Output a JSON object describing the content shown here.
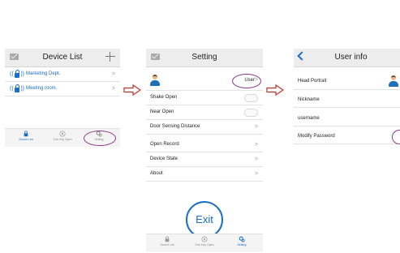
{
  "device_list": {
    "title": "Device List",
    "devices": [
      {
        "label": "Marketing Dept.",
        "chevron": ">"
      },
      {
        "label": "Meeting room.",
        "chevron": ">"
      }
    ],
    "tabs": [
      {
        "label": "Device List",
        "icon": "lock-icon"
      },
      {
        "label": "One Key Open",
        "icon": "compass-icon"
      },
      {
        "label": "Setting",
        "icon": "gear-icon"
      }
    ]
  },
  "setting": {
    "title": "Setting",
    "user_button": "User",
    "rows": [
      {
        "label": "Shake Open",
        "control": "toggle"
      },
      {
        "label": "Near Open",
        "control": "toggle"
      },
      {
        "label": "Door Sensing Distance",
        "chevron": ">"
      },
      {
        "label": "Open Record",
        "chevron": ">"
      },
      {
        "label": "Device State",
        "chevron": ">"
      },
      {
        "label": "About",
        "chevron": ">"
      }
    ],
    "exit_label": "Exit",
    "tabs": [
      {
        "label": "Device List"
      },
      {
        "label": "One Key Open"
      },
      {
        "label": "Setting"
      }
    ]
  },
  "user_info": {
    "title": "User info",
    "rows": [
      {
        "label": "Head Portrait"
      },
      {
        "label": "Nickname"
      },
      {
        "label": "username"
      },
      {
        "label": "Modify Password"
      }
    ]
  },
  "colors": {
    "accent": "#1a6fc4",
    "highlight": "#8e3b86",
    "arrow": "#c0312b"
  }
}
